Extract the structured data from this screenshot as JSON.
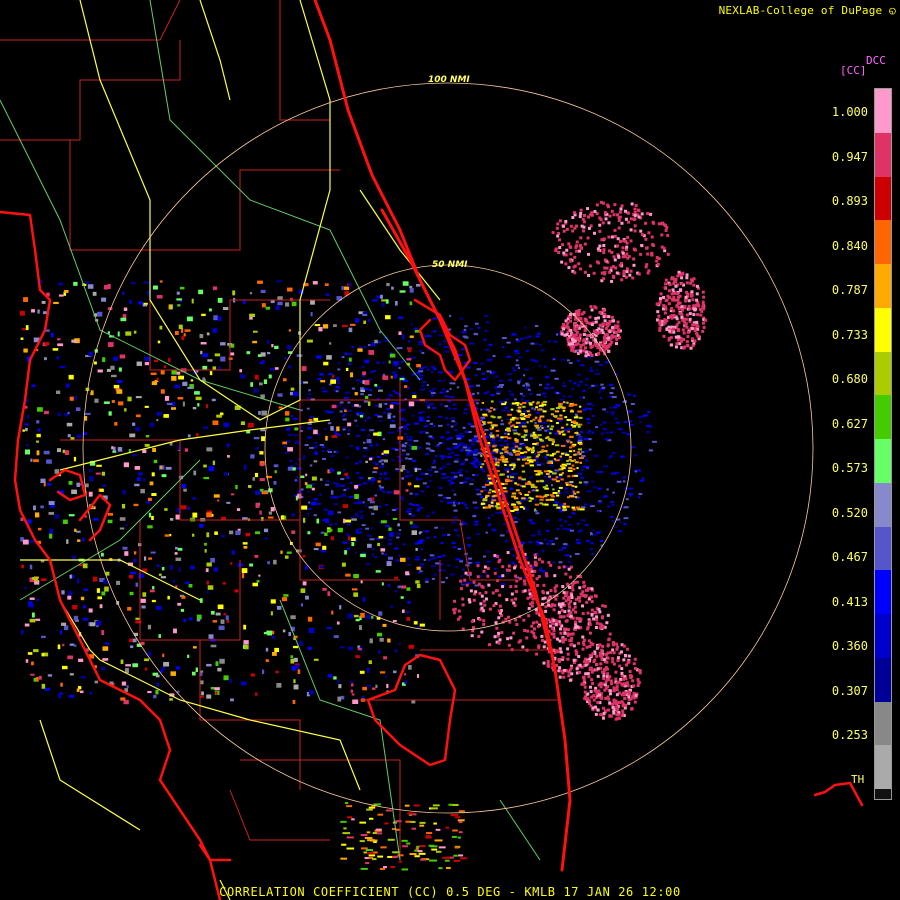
{
  "header": {
    "credit": "NEXLAB-College of DuPage",
    "credit_icon": "logo-icon"
  },
  "legend": {
    "product_code": "DCC",
    "unit": "[CC]",
    "ticks": [
      "1.000",
      "0.947",
      "0.893",
      "0.840",
      "0.787",
      "0.733",
      "0.680",
      "0.627",
      "0.573",
      "0.520",
      "0.467",
      "0.413",
      "0.360",
      "0.307",
      "0.253"
    ],
    "th_label": "TH",
    "colors": [
      "#ff99cc",
      "#dd3366",
      "#cc0000",
      "#ff6600",
      "#ffaa00",
      "#ffff00",
      "#aacc00",
      "#44cc00",
      "#66ff66",
      "#8888cc",
      "#5555cc",
      "#0000ff",
      "#0000cc",
      "#000099",
      "#888888",
      "#aaaaaa"
    ]
  },
  "map": {
    "rings": [
      {
        "label": "100 NMI"
      },
      {
        "label": "50 NMI"
      }
    ],
    "colors": {
      "coast": "#ff2222",
      "highway": "#ffff44",
      "county": "#cc2222",
      "river": "#66cc66",
      "ring": "#ffcc99"
    }
  },
  "footer": {
    "caption": "CORRELATION COEFFICIENT (CC) 0.5 DEG - KMLB 17 JAN 26 12:00"
  }
}
